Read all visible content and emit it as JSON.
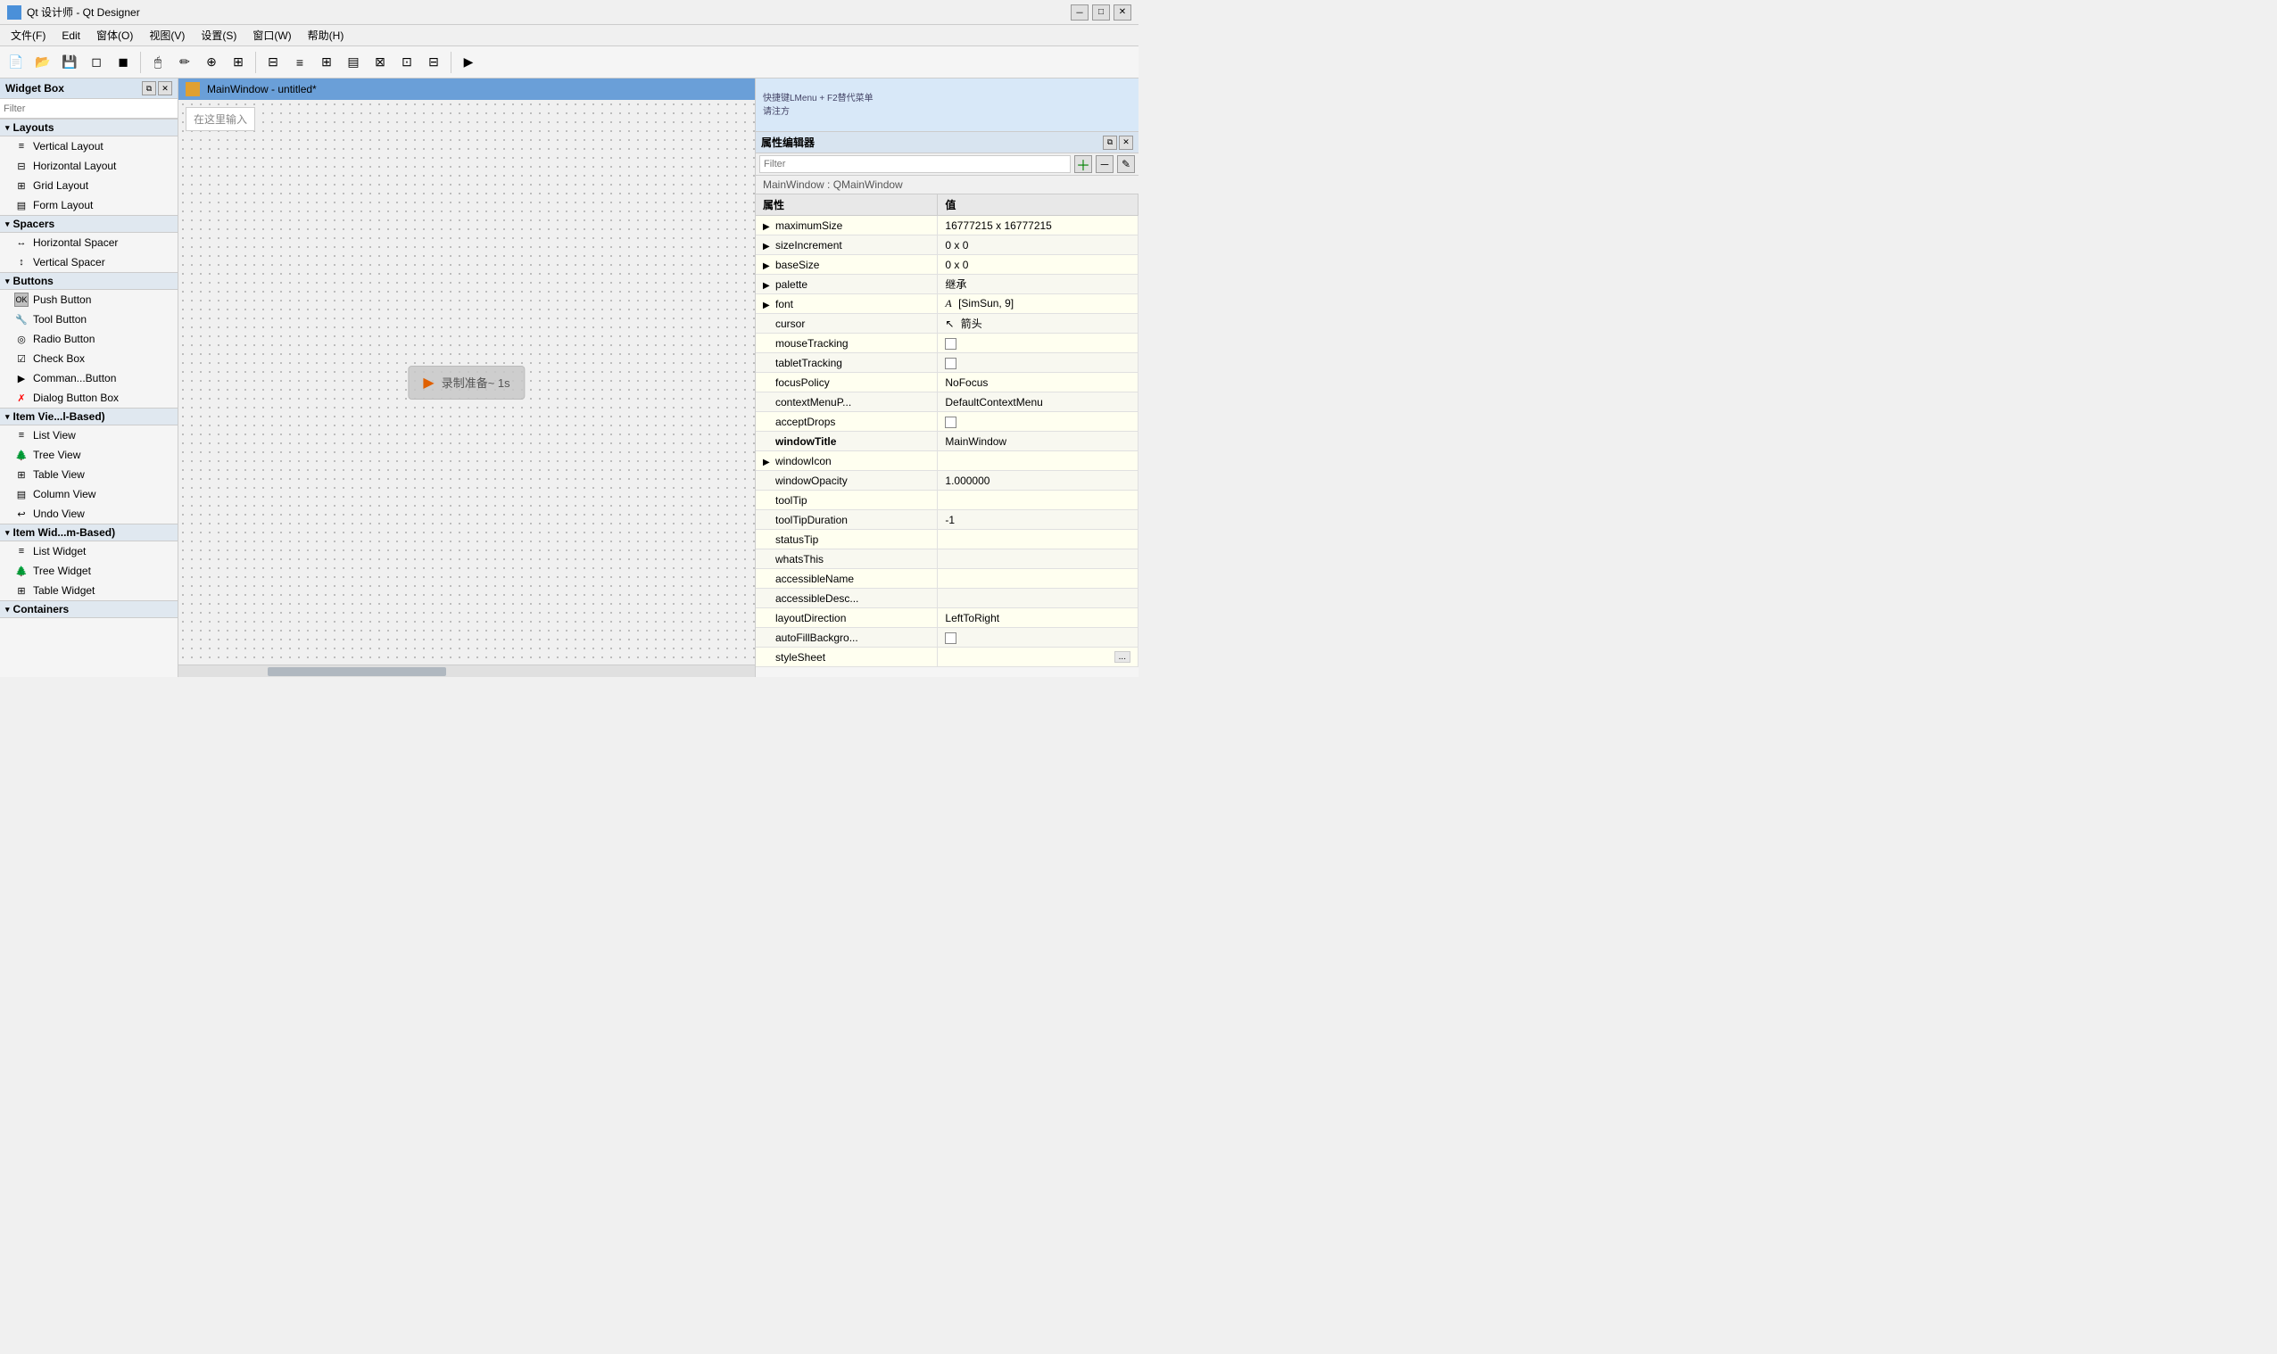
{
  "titleBar": {
    "title": "Qt 设计师 - Qt Designer",
    "icon": "qt-icon"
  },
  "menuBar": {
    "items": [
      {
        "label": "文件(F)"
      },
      {
        "label": "Edit"
      },
      {
        "label": "窗体(O)"
      },
      {
        "label": "视图(V)"
      },
      {
        "label": "设置(S)"
      },
      {
        "label": "窗口(W)"
      },
      {
        "label": "帮助(H)"
      }
    ]
  },
  "widgetBox": {
    "title": "Widget Box",
    "filterPlaceholder": "Filter",
    "sections": [
      {
        "name": "Layouts",
        "items": [
          {
            "label": "Vertical Layout",
            "icon": "≡"
          },
          {
            "label": "Horizontal Layout",
            "icon": "⊟"
          },
          {
            "label": "Grid Layout",
            "icon": "⊞"
          },
          {
            "label": "Form Layout",
            "icon": "▤"
          }
        ]
      },
      {
        "name": "Spacers",
        "items": [
          {
            "label": "Horizontal Spacer",
            "icon": "↔"
          },
          {
            "label": "Vertical Spacer",
            "icon": "↕"
          }
        ]
      },
      {
        "name": "Buttons",
        "items": [
          {
            "label": "Push Button",
            "icon": "OK"
          },
          {
            "label": "Tool Button",
            "icon": "🔧"
          },
          {
            "label": "Radio Button",
            "icon": "◎"
          },
          {
            "label": "Check Box",
            "icon": "☑"
          },
          {
            "label": "Comman...Button",
            "icon": "▶"
          },
          {
            "label": "Dialog Button Box",
            "icon": "✗"
          }
        ]
      },
      {
        "name": "Item Vie...l-Based)",
        "items": [
          {
            "label": "List View",
            "icon": "≡"
          },
          {
            "label": "Tree View",
            "icon": "🌲"
          },
          {
            "label": "Table View",
            "icon": "⊞"
          },
          {
            "label": "Column View",
            "icon": "▤"
          },
          {
            "label": "Undo View",
            "icon": "↩"
          }
        ]
      },
      {
        "name": "Item Wid...m-Based)",
        "items": [
          {
            "label": "List Widget",
            "icon": "≡"
          },
          {
            "label": "Tree Widget",
            "icon": "🌲"
          },
          {
            "label": "Table Widget",
            "icon": "⊞"
          }
        ]
      },
      {
        "name": "Containers",
        "items": []
      }
    ]
  },
  "canvas": {
    "title": "MainWindow - untitled*",
    "subtitle_icon": "mainwindow-icon",
    "inputPlaceholder": "在这里输入",
    "recording": {
      "text": "录制准备~ 1s",
      "icon": "▶"
    }
  },
  "propertyEditor": {
    "title": "属性编辑器",
    "filterPlaceholder": "Filter",
    "classInfo": "MainWindow : QMainWindow",
    "columnHeaders": [
      "属性",
      "值"
    ],
    "properties": [
      {
        "name": "maximumSize",
        "value": "16777215 x 16777215",
        "expandable": true,
        "highlight": false
      },
      {
        "name": "sizeIncrement",
        "value": "0 x 0",
        "expandable": true,
        "highlight": true
      },
      {
        "name": "baseSize",
        "value": "0 x 0",
        "expandable": true,
        "highlight": false
      },
      {
        "name": "palette",
        "value": "继承",
        "expandable": true,
        "highlight": true
      },
      {
        "name": "font",
        "value": "[SimSun, 9]",
        "expandable": true,
        "highlight": false,
        "fontIcon": "A"
      },
      {
        "name": "cursor",
        "value": "箭头",
        "expandable": false,
        "highlight": true,
        "cursorIcon": "↖"
      },
      {
        "name": "mouseTracking",
        "value": "checkbox",
        "expandable": false,
        "highlight": false
      },
      {
        "name": "tabletTracking",
        "value": "checkbox",
        "expandable": false,
        "highlight": true
      },
      {
        "name": "focusPolicy",
        "value": "NoFocus",
        "expandable": false,
        "highlight": false
      },
      {
        "name": "contextMenuP...",
        "value": "DefaultContextMenu",
        "expandable": false,
        "highlight": true
      },
      {
        "name": "acceptDrops",
        "value": "checkbox",
        "expandable": false,
        "highlight": false
      },
      {
        "name": "windowTitle",
        "value": "MainWindow",
        "expandable": false,
        "highlight": true,
        "bold": true
      },
      {
        "name": "windowIcon",
        "value": "",
        "expandable": true,
        "highlight": false
      },
      {
        "name": "windowOpacity",
        "value": "1.000000",
        "expandable": false,
        "highlight": true
      },
      {
        "name": "toolTip",
        "value": "",
        "expandable": false,
        "highlight": false
      },
      {
        "name": "toolTipDuration",
        "value": "-1",
        "expandable": false,
        "highlight": true
      },
      {
        "name": "statusTip",
        "value": "",
        "expandable": false,
        "highlight": false
      },
      {
        "name": "whatsThis",
        "value": "",
        "expandable": false,
        "highlight": true
      },
      {
        "name": "accessibleName",
        "value": "",
        "expandable": false,
        "highlight": false
      },
      {
        "name": "accessibleDesc...",
        "value": "",
        "expandable": false,
        "highlight": true
      },
      {
        "name": "layoutDirection",
        "value": "LeftToRight",
        "expandable": false,
        "highlight": false
      },
      {
        "name": "autoFillBackgro...",
        "value": "checkbox",
        "expandable": false,
        "highlight": true
      },
      {
        "name": "styleSheet",
        "value": "",
        "expandable": false,
        "highlight": false,
        "hasEllipsis": true
      }
    ]
  },
  "topRightPanel": {
    "hint1": "快捷键LMenu + F2替代菜单",
    "hint2": "请注方"
  }
}
